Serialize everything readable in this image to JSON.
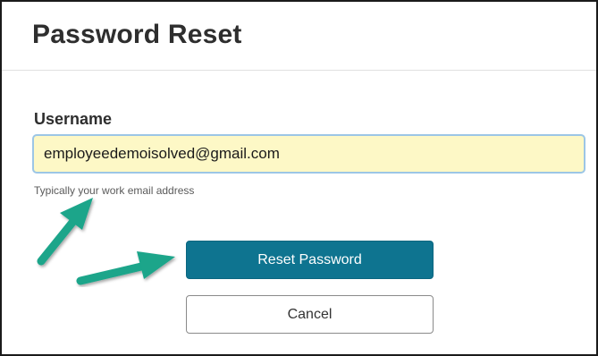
{
  "header": {
    "title": "Password Reset"
  },
  "form": {
    "username_label": "Username",
    "username_value": "employeedemoisolved@gmail.com",
    "username_help": "Typically your work email address",
    "reset_button_label": "Reset Password",
    "cancel_button_label": "Cancel"
  },
  "colors": {
    "primary_button": "#0e7490",
    "input_autofill_bg": "#fdf8c6",
    "annotation_arrow": "#1aa58a"
  },
  "annotations": {
    "arrows": [
      "arrow-to-help-text",
      "arrow-to-reset-button"
    ]
  }
}
